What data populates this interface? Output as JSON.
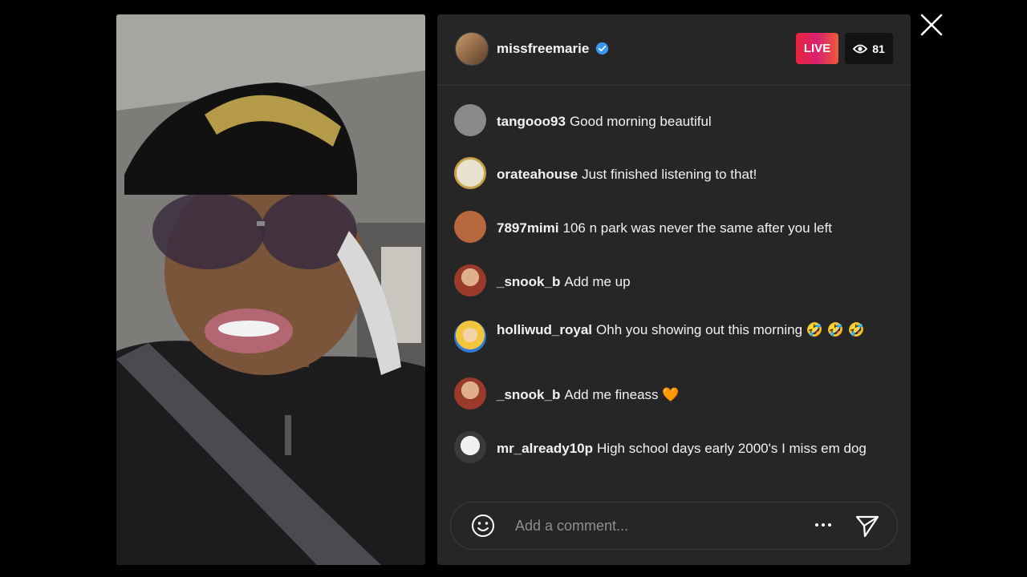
{
  "host": {
    "username": "missfreemarie",
    "verified": true,
    "live_label": "LIVE",
    "viewer_count": "81"
  },
  "comments": [
    {
      "user": "tangooo93",
      "text": "Good morning beautiful",
      "avatar_color": "#8a8a8a"
    },
    {
      "user": "orateahouse",
      "text": "Just finished listening to that!",
      "avatar_color": "#e8e2cf"
    },
    {
      "user": "7897mimi",
      "text": "106 n park was never the same after you left",
      "avatar_color": "#b8683d"
    },
    {
      "user": "_snook_b",
      "text": "Add me up",
      "avatar_color": "#9a3a2a"
    },
    {
      "user": "holliwud_royal",
      "text": "Ohh you showing out this morning 🤣 🤣 🤣",
      "avatar_color": "#f2c53d"
    },
    {
      "user": "_snook_b",
      "text": "Add me fineass 🧡",
      "avatar_color": "#9a3a2a"
    },
    {
      "user": "mr_already10p",
      "text": "High school days early 2000's I miss em dog",
      "avatar_color": "#d9d9d9"
    }
  ],
  "comment_input": {
    "placeholder": "Add a comment..."
  },
  "icons": {
    "close": "close-icon",
    "emoji": "emoji-icon",
    "more": "more-icon",
    "send": "send-icon",
    "views": "eye-icon",
    "verified": "verified-badge-icon"
  },
  "colors": {
    "panel_bg": "#262626",
    "live_gradient_start": "#e8243b",
    "live_gradient_end": "#f0593a",
    "verified_blue": "#3897f0"
  }
}
